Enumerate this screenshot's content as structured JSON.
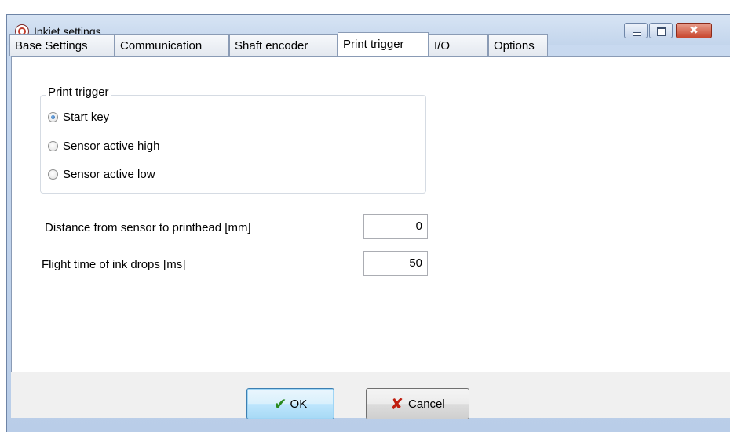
{
  "window": {
    "title": "Inkjet settings",
    "icon": "app-logo-icon",
    "controls": {
      "minimize": "minimize-icon",
      "maximize": "maximize-icon",
      "close": "✖"
    }
  },
  "tabs": [
    {
      "label": "Base Settings",
      "active": false
    },
    {
      "label": "Communication",
      "active": false
    },
    {
      "label": "Shaft encoder",
      "active": false
    },
    {
      "label": "Print trigger",
      "active": true
    },
    {
      "label": "I/O",
      "active": false
    },
    {
      "label": "Options",
      "active": false
    }
  ],
  "print_trigger": {
    "group_title": "Print trigger",
    "options": [
      {
        "label": "Start key",
        "checked": true
      },
      {
        "label": "Sensor active high",
        "checked": false
      },
      {
        "label": "Sensor active low",
        "checked": false
      }
    ]
  },
  "fields": {
    "distance_label": "Distance from sensor to printhead [mm]",
    "distance_value": "0",
    "flight_label": "Flight time of ink drops [ms]",
    "flight_value": "50"
  },
  "buttons": {
    "ok_label": "OK",
    "cancel_label": "Cancel"
  },
  "colors": {
    "accent": "#3c7fb1",
    "ok_icon": "#2a8a1e",
    "cancel_icon": "#c01f10"
  }
}
